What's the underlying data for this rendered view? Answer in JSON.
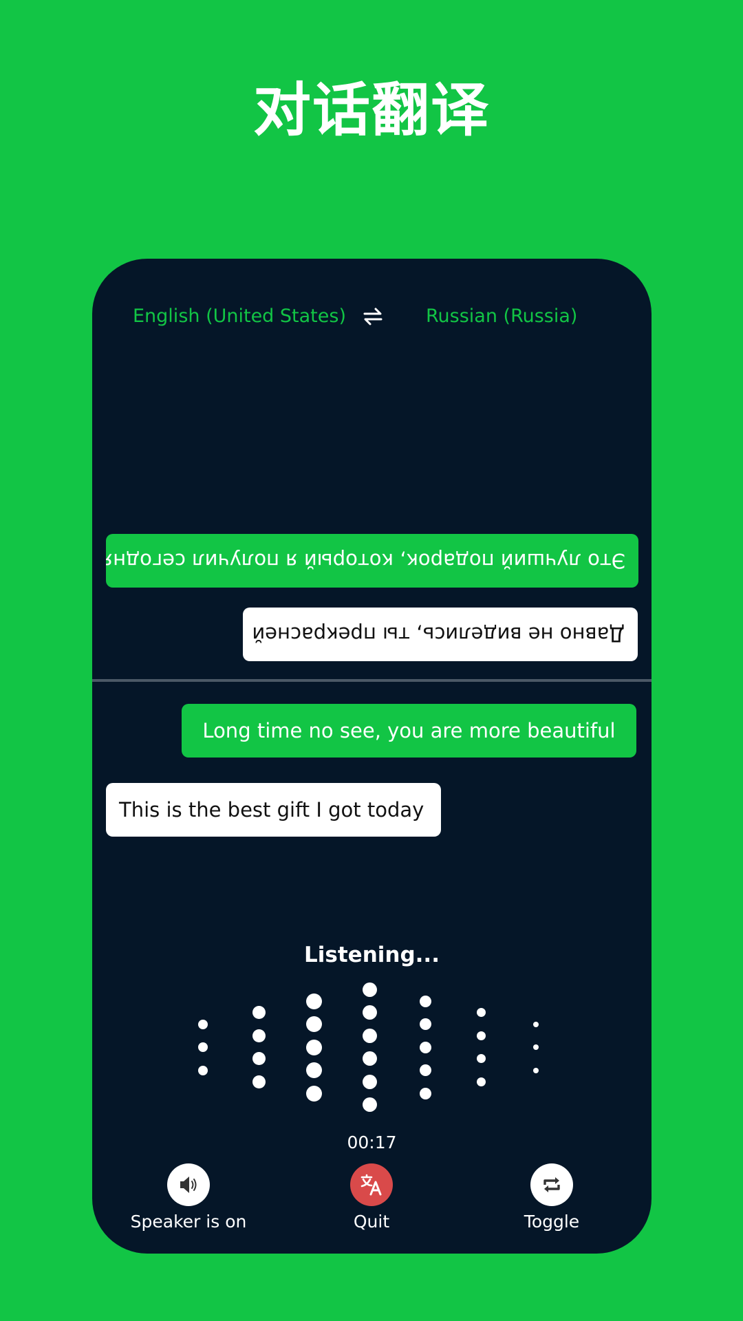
{
  "page": {
    "title": "对话翻译",
    "background_color": "#12c545"
  },
  "languages": {
    "source": "English (United States)",
    "target": "Russian (Russia)",
    "swap_icon": "swap-arrows-icon"
  },
  "conversation": {
    "top_half_rotated": true,
    "top_messages": [
      {
        "text": "Это лучший подарок, который я получил сегодня",
        "style": "green"
      },
      {
        "text": "Давно не виделись, ты прекрасней",
        "style": "white"
      }
    ],
    "bottom_messages": [
      {
        "text": "Long time no see, you are more beautiful",
        "style": "green"
      },
      {
        "text": "This is the best gift I got today",
        "style": "white"
      }
    ]
  },
  "recorder": {
    "status": "Listening...",
    "timer": "00:17",
    "waveform_levels": [
      3,
      4,
      5,
      6,
      5,
      4,
      3
    ]
  },
  "controls": [
    {
      "id": "speaker",
      "label": "Speaker is on",
      "icon": "speaker-icon",
      "circle_color": "#ffffff"
    },
    {
      "id": "quit",
      "label": "Quit",
      "icon": "translate-icon",
      "circle_color": "#d94a4a"
    },
    {
      "id": "toggle",
      "label": "Toggle",
      "icon": "repeat-icon",
      "circle_color": "#ffffff"
    }
  ],
  "colors": {
    "accent": "#12c545",
    "panel": "#051628",
    "quit": "#d94a4a",
    "divider": "#4b5866"
  }
}
